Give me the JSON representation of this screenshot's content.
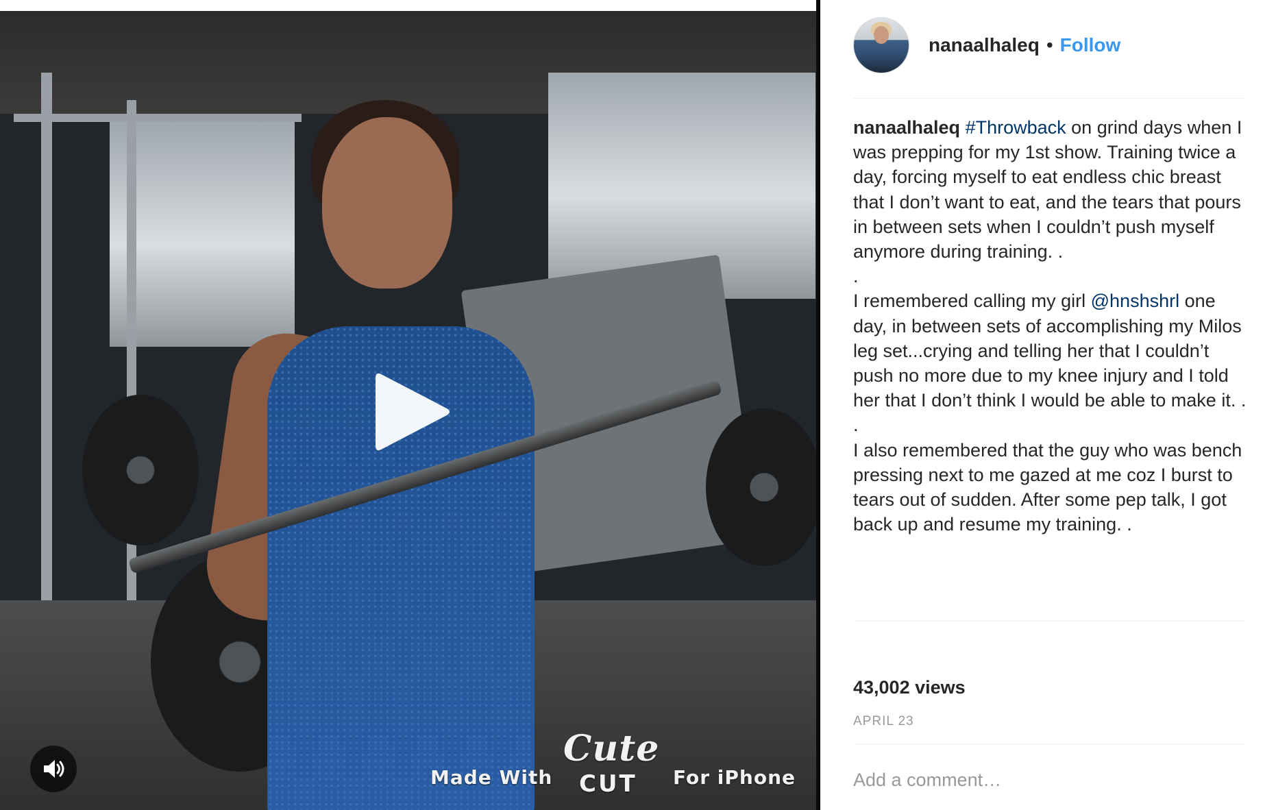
{
  "video": {
    "watermark": {
      "made_with": "Made With",
      "cute": "Cute",
      "cut": "CUT",
      "for_iphone": "For iPhone"
    },
    "play_icon": "play-icon",
    "mute_icon": "speaker-icon"
  },
  "post": {
    "username": "nanaalhaleq",
    "separator": "•",
    "follow_label": "Follow",
    "caption": {
      "username": "nanaalhaleq",
      "hashtag": "#Throwback",
      "p1_rest": " on grind days when I was prepping for my 1st show. Training twice a day, forcing myself to eat endless chic breast that I don’t want to eat, and the tears that pours in between sets when I couldn’t push myself anymore during training. .",
      "dot1": ".",
      "p2_before": "I remembered calling my girl ",
      "mention": "@hnshshrl",
      "p2_after": " one day, in between sets of accomplishing my Milos leg set...crying and telling her that I couldn’t push no more due to my knee injury and I told her that I don’t think I would be able to make it. .",
      "dot2": ".",
      "p3": "I also remembered that the guy who was bench pressing next to me gazed at me coz I burst to tears out of sudden. After some pep talk, I got back up and resume my training. ."
    },
    "views": "43,002 views",
    "date": "APRIL 23",
    "comment_placeholder": "Add a comment…"
  },
  "colors": {
    "link": "#3897f0",
    "hashtag": "#003569",
    "text": "#262626",
    "muted": "#999999"
  }
}
